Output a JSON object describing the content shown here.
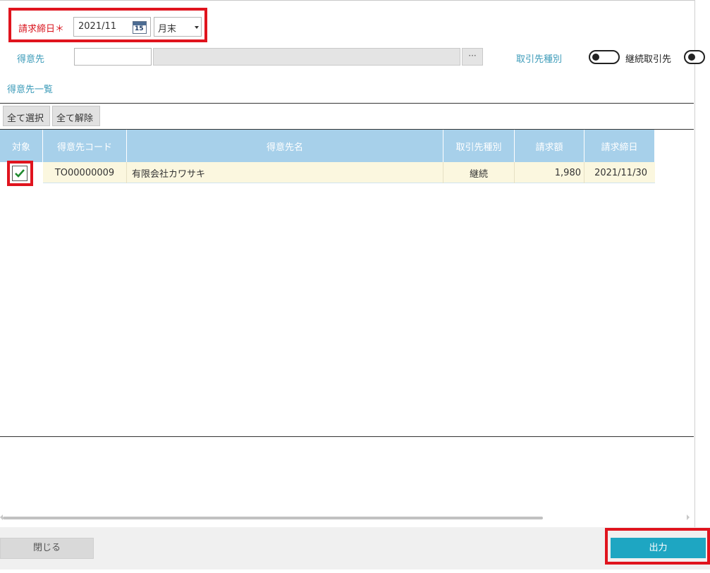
{
  "form": {
    "billing_date_label": "請求締日",
    "required_mark": "＊",
    "billing_date_value": "2021/11",
    "calendar_icon": "calendar-icon",
    "calendar_icon_number": "15",
    "closing_select_value": "月末",
    "customer_label": "得意先",
    "customer_code_value": "",
    "customer_name_value": "",
    "lookup_button_label": "···",
    "partner_type_label": "取引先種別",
    "continuing_toggle_label": "継続取引先"
  },
  "list": {
    "title": "得意先一覧",
    "select_all_label": "全て選択",
    "deselect_all_label": "全て解除",
    "columns": [
      "対象",
      "得意先コード",
      "得意先名",
      "取引先種別",
      "請求額",
      "請求締日"
    ],
    "rows": [
      {
        "checked": true,
        "code": "TO00000009",
        "name": "有限会社カワサキ",
        "type": "継続",
        "amount": "1,980",
        "closing_date": "2021/11/30"
      }
    ]
  },
  "footer": {
    "close_label": "閉じる",
    "output_label": "出力"
  },
  "colors": {
    "highlight": "#e0141e",
    "label_blue": "#3c9bb9",
    "header_blue": "#a7d0ea",
    "row_bg": "#fbf7df",
    "primary_button": "#1ea6c2"
  }
}
